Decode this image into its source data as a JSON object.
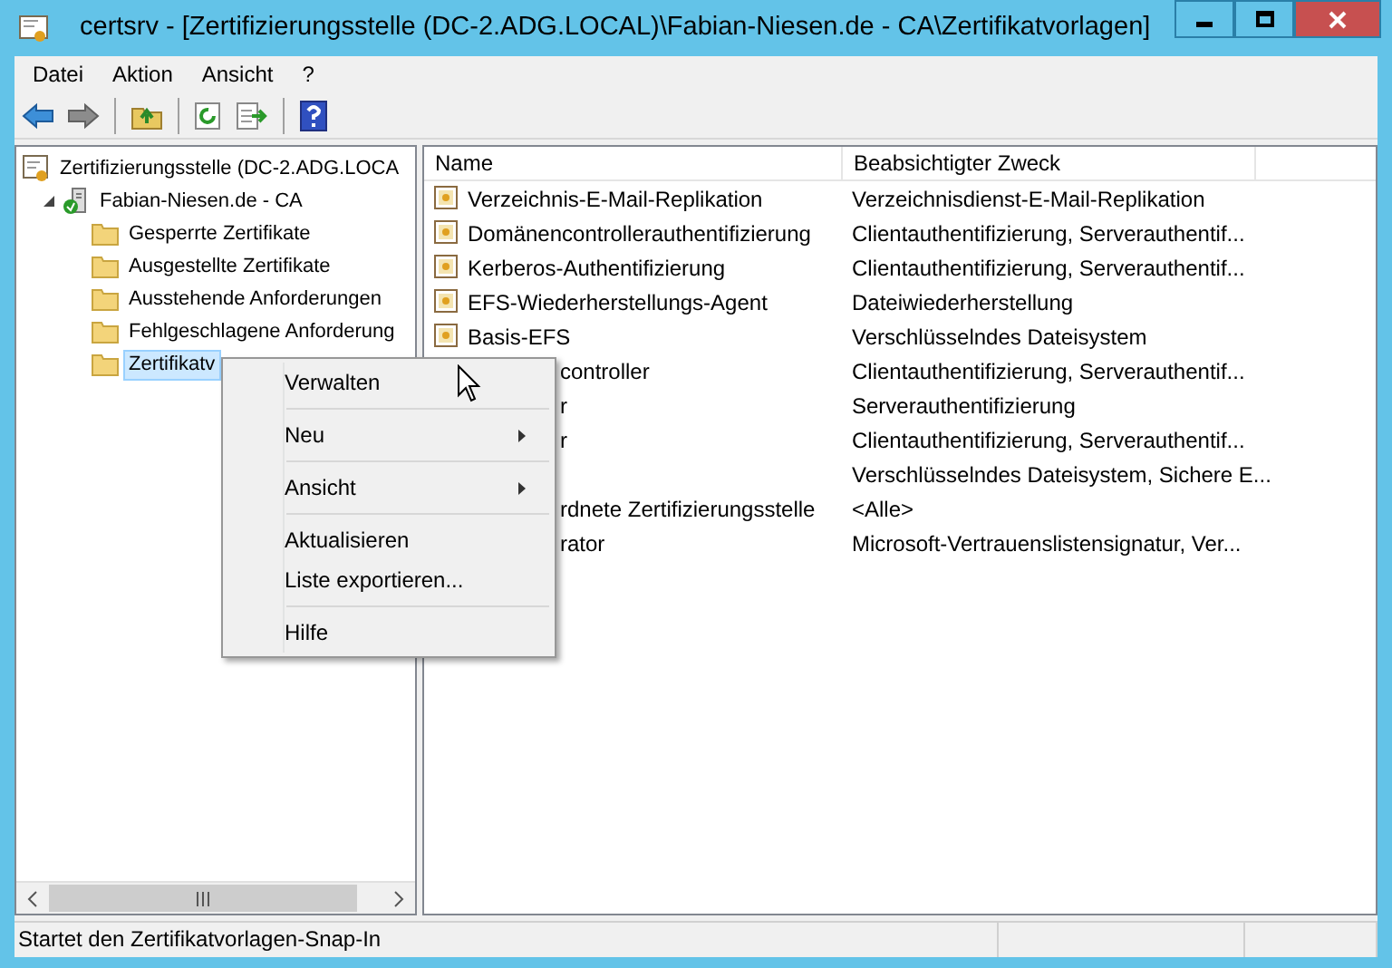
{
  "window": {
    "title": "certsrv - [Zertifizierungsstelle (DC-2.ADG.LOCAL)\\Fabian-Niesen.de - CA\\Zertifikatvorlagen]"
  },
  "menu_bar": [
    "Datei",
    "Aktion",
    "Ansicht",
    "?"
  ],
  "tree": {
    "label": "Zertifizierungsstelle (DC-2.ADG.LOCA",
    "kind": "root",
    "children": [
      {
        "label": "Fabian-Niesen.de - CA",
        "kind": "ca",
        "expanded": true,
        "children": [
          {
            "label": "Gesperrte Zertifikate",
            "kind": "folder",
            "selected": false
          },
          {
            "label": "Ausgestellte Zertifikate",
            "kind": "folder",
            "selected": false
          },
          {
            "label": "Ausstehende Anforderungen",
            "kind": "folder",
            "selected": false
          },
          {
            "label": "Fehlgeschlagene Anforderung",
            "kind": "folder",
            "selected": false
          },
          {
            "label": "Zertifikatv",
            "kind": "folder",
            "selected": true
          }
        ]
      }
    ]
  },
  "list": {
    "columns": [
      "Name",
      "Beabsichtigter Zweck"
    ],
    "rows": [
      {
        "kind": "full",
        "name": "Verzeichnis-E-Mail-Replikation",
        "purpose": "Verzeichnisdienst-E-Mail-Replikation"
      },
      {
        "kind": "full",
        "name": "Domänencontrollerauthentifizierung",
        "purpose": "Clientauthentifizierung, Serverauthentif..."
      },
      {
        "kind": "full",
        "name": "Kerberos-Authentifizierung",
        "purpose": "Clientauthentifizierung, Serverauthentif..."
      },
      {
        "kind": "full",
        "name": "EFS-Wiederherstellungs-Agent",
        "purpose": "Dateiwiederherstellung"
      },
      {
        "kind": "full",
        "name": "Basis-EFS",
        "purpose": "Verschlüsselndes Dateisystem"
      },
      {
        "kind": "covered",
        "name": "controller",
        "purpose": "Clientauthentifizierung, Serverauthentif..."
      },
      {
        "kind": "covered",
        "name": "r",
        "purpose": "Serverauthentifizierung"
      },
      {
        "kind": "covered",
        "name": "r",
        "purpose": "Clientauthentifizierung, Serverauthentif..."
      },
      {
        "kind": "covered",
        "purpose": "Verschlüsselndes Dateisystem, Sichere E..."
      },
      {
        "kind": "covered",
        "name": "rdnete Zertifizierungsstelle",
        "purpose": "<Alle>"
      },
      {
        "kind": "covered",
        "name": "rator",
        "purpose": "Microsoft-Vertrauenslistensignatur, Ver..."
      }
    ]
  },
  "context_menu": [
    {
      "kind": "item",
      "label": "Verwalten"
    },
    {
      "kind": "separator"
    },
    {
      "kind": "submenu",
      "label": "Neu"
    },
    {
      "kind": "separator"
    },
    {
      "kind": "submenu",
      "label": "Ansicht"
    },
    {
      "kind": "separator"
    },
    {
      "kind": "item",
      "label": "Aktualisieren"
    },
    {
      "kind": "item",
      "label": "Liste exportieren..."
    },
    {
      "kind": "separator"
    },
    {
      "kind": "item",
      "label": "Hilfe"
    }
  ],
  "status_bar": {
    "text": "Startet den Zertifikatvorlagen-Snap-In"
  }
}
